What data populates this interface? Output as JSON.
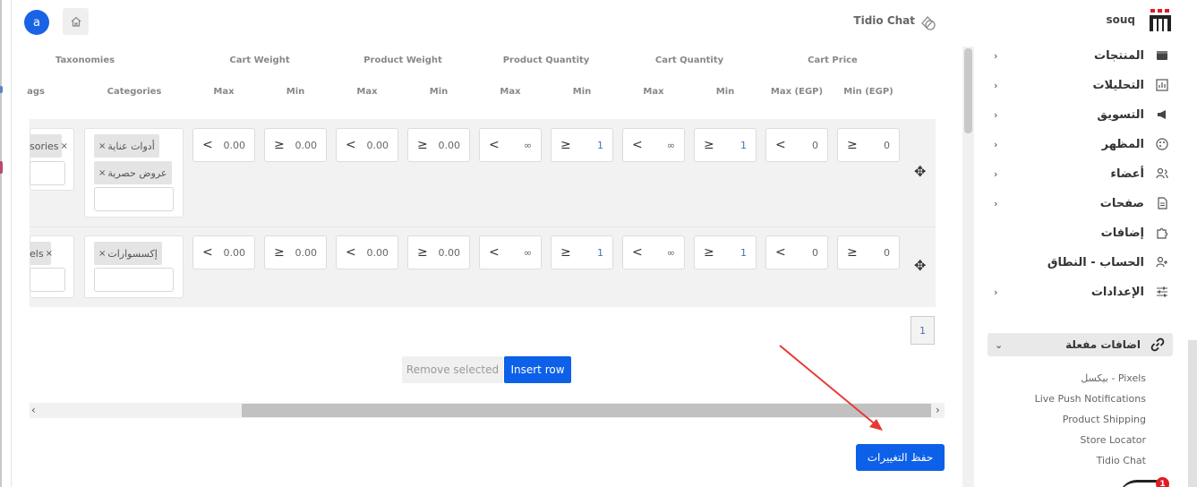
{
  "header": {
    "avatar_initial": "a",
    "app_title": "Tidio Chat",
    "brand_name": "souq"
  },
  "table": {
    "group_headers": [
      "Taxonomies",
      "Cart Weight",
      "Product Weight",
      "Product Quantity",
      "Cart Quantity",
      "Cart Price"
    ],
    "column_headers": [
      "ags",
      "Categories",
      "Max",
      "Min",
      "Max",
      "Min",
      "Max",
      "Min",
      "Max",
      "Min",
      "Max (EGP)",
      "Min (EGP)"
    ],
    "rows": [
      {
        "tags_partial": [
          "sories"
        ],
        "categories": [
          "أدوات عناية",
          "عروض حصرية"
        ],
        "cells": [
          {
            "op": "<",
            "value": "0.00"
          },
          {
            "op": "≥",
            "value": "0.00"
          },
          {
            "op": "<",
            "value": "0.00"
          },
          {
            "op": "≥",
            "value": "0.00"
          },
          {
            "op": "<",
            "value": "∞"
          },
          {
            "op": "≥",
            "value": "1"
          },
          {
            "op": "<",
            "value": "∞"
          },
          {
            "op": "≥",
            "value": "1"
          },
          {
            "op": "<",
            "value": "0"
          },
          {
            "op": "≥",
            "value": "0"
          }
        ]
      },
      {
        "tags_partial": [
          "els"
        ],
        "categories": [
          "إكسسوارات"
        ],
        "cells": [
          {
            "op": "<",
            "value": "0.00"
          },
          {
            "op": "≥",
            "value": "0.00"
          },
          {
            "op": "<",
            "value": "0.00"
          },
          {
            "op": "≥",
            "value": "0.00"
          },
          {
            "op": "<",
            "value": "∞"
          },
          {
            "op": "≥",
            "value": "1"
          },
          {
            "op": "<",
            "value": "∞"
          },
          {
            "op": "≥",
            "value": "1"
          },
          {
            "op": "<",
            "value": "0"
          },
          {
            "op": "≥",
            "value": "0"
          }
        ]
      }
    ],
    "tag_remove_glyph": "×",
    "current_page": "1",
    "remove_selected_label": "Remove selected",
    "insert_row_label": "Insert row"
  },
  "save_label": "حفظ التغييرات",
  "sidebar": {
    "items": [
      {
        "label": "المنتجات",
        "icon": "box-icon",
        "has_chevron": true
      },
      {
        "label": "التحليلات",
        "icon": "chart-icon",
        "has_chevron": true
      },
      {
        "label": "التسويق",
        "icon": "megaphone-icon",
        "has_chevron": true
      },
      {
        "label": "المظهر",
        "icon": "palette-icon",
        "has_chevron": true
      },
      {
        "label": "أعضاء",
        "icon": "users-icon",
        "has_chevron": true
      },
      {
        "label": "صفحات",
        "icon": "page-icon",
        "has_chevron": true
      },
      {
        "label": "إضافات",
        "icon": "puzzle-icon",
        "has_chevron": false
      },
      {
        "label": "الحساب - النطاق",
        "icon": "account-icon",
        "has_chevron": false
      },
      {
        "label": "الإعدادات",
        "icon": "sliders-icon",
        "has_chevron": true
      }
    ],
    "active_addons": {
      "label": "اضافات مفعلة",
      "items": [
        "بيكسل - Pixels",
        "Live Push Notifications",
        "Product Shipping",
        "Store Locator",
        "Tidio Chat"
      ]
    },
    "notification_count": "1"
  }
}
